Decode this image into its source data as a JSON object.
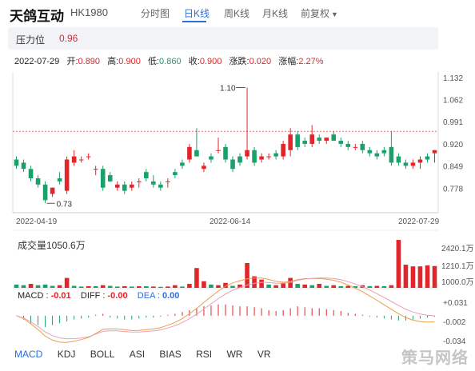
{
  "header": {
    "title": "天鸽互动",
    "code": "HK1980",
    "tabs": [
      {
        "label": "分时图",
        "active": false
      },
      {
        "label": "日K线",
        "active": true
      },
      {
        "label": "周K线",
        "active": false
      },
      {
        "label": "月K线",
        "active": false
      },
      {
        "label": "前复权",
        "active": false
      }
    ]
  },
  "pressure": {
    "label": "压力位",
    "value": "0.96"
  },
  "quote": {
    "date": "2022-07-29",
    "open_label": "开:",
    "open": "0.890",
    "high_label": "高:",
    "high": "0.900",
    "low_label": "低:",
    "low": "0.860",
    "close_label": "收:",
    "close": "0.900",
    "change_label": "涨跌:",
    "change": "0.020",
    "pct_label": "涨幅:",
    "pct": "2.27%"
  },
  "volume": {
    "label": "成交量1050.6万",
    "ticks": [
      "2420.1万",
      "1210.1万",
      "1000.0万"
    ]
  },
  "macd": {
    "macd_label": "MACD : ",
    "macd": "-0.01",
    "diff_label": "DIFF : ",
    "diff": "-0.00",
    "dea_label": "DEA : ",
    "dea": "0.00",
    "ticks": [
      "+0.031",
      "-0.002",
      "-0.034"
    ]
  },
  "indicator_tabs": [
    "MACD",
    "KDJ",
    "BOLL",
    "ASI",
    "BIAS",
    "RSI",
    "WR",
    "VR"
  ],
  "watermark": "策马网络",
  "colors": {
    "up": "#e0262a",
    "down": "#1aa169",
    "accent": "#2b6de3",
    "dif": "#e8a04a",
    "dea": "#e8a0b8"
  },
  "chart_data": {
    "type": "candlestick",
    "y_ticks": [
      "1.132",
      "1.062",
      "0.991",
      "0.920",
      "0.849",
      "0.778"
    ],
    "ylim": [
      0.7,
      1.15
    ],
    "x_ticks": [
      "2022-04-19",
      "2022-06-14",
      "2022-07-29"
    ],
    "resistance": 0.96,
    "annotations": [
      {
        "text": "1.10"
      },
      {
        "text": "0.73"
      }
    ],
    "candles": [
      [
        0.87,
        0.88,
        0.84,
        0.85
      ],
      [
        0.86,
        0.87,
        0.83,
        0.84
      ],
      [
        0.84,
        0.85,
        0.8,
        0.81
      ],
      [
        0.81,
        0.82,
        0.78,
        0.79
      ],
      [
        0.79,
        0.8,
        0.73,
        0.74
      ],
      [
        0.76,
        0.78,
        0.75,
        0.78
      ],
      [
        0.81,
        0.83,
        0.79,
        0.8
      ],
      [
        0.77,
        0.88,
        0.76,
        0.87
      ],
      [
        0.86,
        0.9,
        0.85,
        0.88
      ],
      [
        0.87,
        0.88,
        0.86,
        0.87
      ],
      [
        0.88,
        0.89,
        0.87,
        0.88
      ],
      [
        0.84,
        0.85,
        0.82,
        0.84
      ],
      [
        0.84,
        0.85,
        0.77,
        0.78
      ],
      [
        0.82,
        0.83,
        0.8,
        0.8
      ],
      [
        0.78,
        0.8,
        0.77,
        0.79
      ],
      [
        0.79,
        0.8,
        0.76,
        0.77
      ],
      [
        0.78,
        0.8,
        0.77,
        0.79
      ],
      [
        0.8,
        0.81,
        0.78,
        0.8
      ],
      [
        0.83,
        0.84,
        0.8,
        0.81
      ],
      [
        0.8,
        0.82,
        0.78,
        0.79
      ],
      [
        0.79,
        0.8,
        0.77,
        0.78
      ],
      [
        0.8,
        0.81,
        0.78,
        0.8
      ],
      [
        0.83,
        0.84,
        0.81,
        0.82
      ],
      [
        0.86,
        0.87,
        0.84,
        0.85
      ],
      [
        0.87,
        0.92,
        0.86,
        0.91
      ],
      [
        0.9,
        0.97,
        0.89,
        0.88
      ],
      [
        0.84,
        0.86,
        0.83,
        0.85
      ],
      [
        0.88,
        0.89,
        0.86,
        0.87
      ],
      [
        0.9,
        0.94,
        0.89,
        0.9
      ],
      [
        0.91,
        0.92,
        0.86,
        0.87
      ],
      [
        0.87,
        0.88,
        0.83,
        0.84
      ],
      [
        0.88,
        0.89,
        0.85,
        0.86
      ],
      [
        0.88,
        1.1,
        0.87,
        0.9
      ],
      [
        0.9,
        0.91,
        0.85,
        0.86
      ],
      [
        0.87,
        0.89,
        0.86,
        0.88
      ],
      [
        0.88,
        0.89,
        0.87,
        0.88
      ],
      [
        0.89,
        0.9,
        0.87,
        0.88
      ],
      [
        0.88,
        0.93,
        0.87,
        0.92
      ],
      [
        0.9,
        0.97,
        0.88,
        0.95
      ],
      [
        0.95,
        0.96,
        0.9,
        0.91
      ],
      [
        0.93,
        0.94,
        0.91,
        0.92
      ],
      [
        0.92,
        0.98,
        0.91,
        0.95
      ],
      [
        0.94,
        0.95,
        0.92,
        0.93
      ],
      [
        0.93,
        0.94,
        0.92,
        0.94
      ],
      [
        0.95,
        0.96,
        0.93,
        0.93
      ],
      [
        0.93,
        0.94,
        0.91,
        0.92
      ],
      [
        0.92,
        0.93,
        0.9,
        0.91
      ],
      [
        0.91,
        0.92,
        0.9,
        0.91
      ],
      [
        0.92,
        0.93,
        0.89,
        0.9
      ],
      [
        0.9,
        0.91,
        0.88,
        0.89
      ],
      [
        0.89,
        0.9,
        0.87,
        0.88
      ],
      [
        0.9,
        0.91,
        0.88,
        0.89
      ],
      [
        0.91,
        0.96,
        0.85,
        0.86
      ],
      [
        0.88,
        0.89,
        0.85,
        0.86
      ],
      [
        0.86,
        0.87,
        0.84,
        0.85
      ],
      [
        0.85,
        0.87,
        0.84,
        0.86
      ],
      [
        0.86,
        0.88,
        0.84,
        0.87
      ],
      [
        0.88,
        0.89,
        0.86,
        0.87
      ],
      [
        0.89,
        0.9,
        0.86,
        0.9
      ]
    ],
    "volume": [
      [
        "down",
        0.1
      ],
      [
        "down",
        0.08
      ],
      [
        "up",
        0.12
      ],
      [
        "down",
        0.08
      ],
      [
        "down",
        0.1
      ],
      [
        "down",
        0.06
      ],
      [
        "up",
        0.08
      ],
      [
        "up",
        0.3
      ],
      [
        "down",
        0.06
      ],
      [
        "down",
        0.04
      ],
      [
        "up",
        0.05
      ],
      [
        "down",
        0.05
      ],
      [
        "up",
        0.08
      ],
      [
        "down",
        0.06
      ],
      [
        "down",
        0.04
      ],
      [
        "up",
        0.05
      ],
      [
        "down",
        0.04
      ],
      [
        "up",
        0.05
      ],
      [
        "down",
        0.05
      ],
      [
        "up",
        0.04
      ],
      [
        "down",
        0.03
      ],
      [
        "up",
        0.04
      ],
      [
        "up",
        0.08
      ],
      [
        "down",
        0.04
      ],
      [
        "up",
        0.12
      ],
      [
        "up",
        0.6
      ],
      [
        "up",
        0.2
      ],
      [
        "down",
        0.1
      ],
      [
        "up",
        0.08
      ],
      [
        "up",
        0.15
      ],
      [
        "down",
        0.06
      ],
      [
        "up",
        0.1
      ],
      [
        "up",
        0.75
      ],
      [
        "up",
        0.35
      ],
      [
        "up",
        0.25
      ],
      [
        "down",
        0.1
      ],
      [
        "up",
        0.08
      ],
      [
        "up",
        0.15
      ],
      [
        "up",
        0.3
      ],
      [
        "down",
        0.12
      ],
      [
        "up",
        0.1
      ],
      [
        "down",
        0.08
      ],
      [
        "up",
        0.12
      ],
      [
        "down",
        0.06
      ],
      [
        "up",
        0.08
      ],
      [
        "down",
        0.05
      ],
      [
        "up",
        0.06
      ],
      [
        "down",
        0.05
      ],
      [
        "up",
        0.08
      ],
      [
        "down",
        0.05
      ],
      [
        "up",
        0.06
      ],
      [
        "down",
        0.05
      ],
      [
        "up",
        0.08
      ],
      [
        "up",
        1.45
      ],
      [
        "up",
        0.7
      ],
      [
        "up",
        0.65
      ],
      [
        "up",
        0.65
      ],
      [
        "up",
        0.68
      ],
      [
        "up",
        0.66
      ]
    ],
    "macd_hist": [
      0.0,
      -0.004,
      -0.008,
      -0.01,
      -0.012,
      -0.01,
      -0.008,
      -0.006,
      -0.004,
      -0.003,
      -0.002,
      0.001,
      0.002,
      -0.002,
      -0.003,
      -0.004,
      -0.004,
      -0.003,
      -0.002,
      -0.002,
      -0.001,
      0.001,
      0.002,
      0.004,
      0.006,
      0.008,
      0.01,
      0.011,
      0.012,
      0.012,
      0.011,
      0.01,
      0.01,
      0.009,
      0.008,
      0.006,
      0.005,
      0.006,
      0.008,
      0.01,
      0.009,
      0.008,
      0.008,
      0.007,
      0.006,
      0.005,
      0.003,
      0.002,
      0.001,
      -0.001,
      -0.002,
      -0.003,
      -0.004,
      -0.005,
      -0.005,
      -0.004,
      -0.003,
      -0.002,
      -0.001
    ],
    "macd_ylim": [
      -0.034,
      0.031
    ]
  }
}
